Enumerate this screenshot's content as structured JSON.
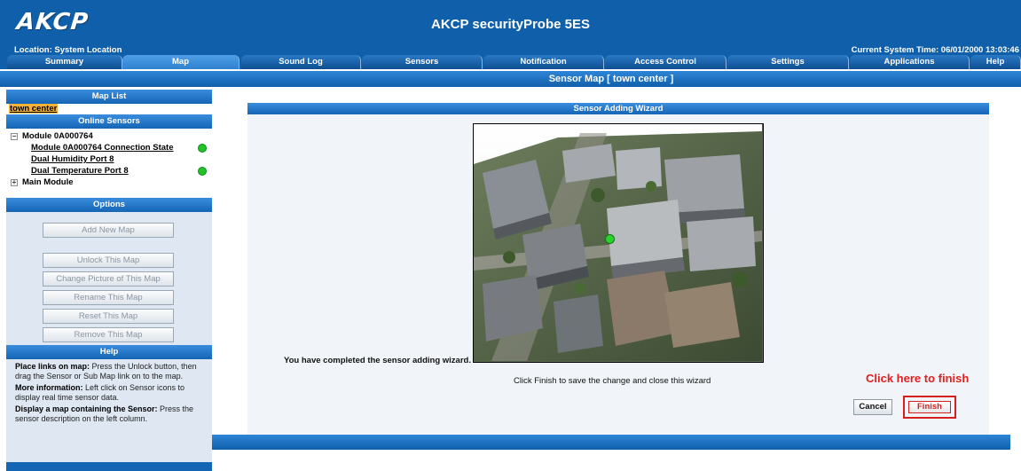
{
  "header": {
    "logo": "AKCP",
    "product_title": "AKCP securityProbe 5ES",
    "location": "Location: System Location",
    "system_time": "Current System Time: 06/01/2000 13:03:46"
  },
  "tabs": [
    {
      "label": "Summary",
      "active": false
    },
    {
      "label": "Map",
      "active": true
    },
    {
      "label": "Sound Log",
      "active": false
    },
    {
      "label": "Sensors",
      "active": false
    },
    {
      "label": "Notification",
      "active": false
    },
    {
      "label": "Access Control",
      "active": false
    },
    {
      "label": "Settings",
      "active": false
    },
    {
      "label": "Applications",
      "active": false
    },
    {
      "label": "Help",
      "active": false
    }
  ],
  "page_title": "Sensor Map [ town center ]",
  "sidebar": {
    "map_list_title": "Map List",
    "map_link": "town center",
    "online_sensors_title": "Online Sensors",
    "module_name": "Module 0A000764",
    "sensors": [
      {
        "label": "Module 0A000764 Connection State",
        "status": "online"
      },
      {
        "label": "Dual Humidity Port 8",
        "status": "none"
      },
      {
        "label": "Dual Temperature Port 8",
        "status": "online"
      }
    ],
    "main_module": "Main Module",
    "options_title": "Options",
    "options": [
      "Add New Map",
      "Unlock This Map",
      "Change Picture of This Map",
      "Rename This Map",
      "Reset This Map",
      "Remove This Map"
    ],
    "help_title": "Help",
    "help": {
      "p1_bold": "Place links on map:",
      "p1_text": " Press the Unlock button, then drag the Sensor or Sub Map link on to the map.",
      "p2_bold": "More information:",
      "p2_text": " Left click on Sensor icons to display real time sensor data.",
      "p3_bold": "Display a map containing the Sensor:",
      "p3_text": " Press the sensor description on the left column."
    }
  },
  "wizard": {
    "title": "Sensor Adding Wizard",
    "completed_message": "You have completed the sensor adding wizard.",
    "finish_instruction": "Click Finish to save the change and close this wizard",
    "callout": "Click here to finish",
    "cancel_label": "Cancel",
    "finish_label": "Finish"
  },
  "colors": {
    "header_blue": "#0f5faa",
    "online_green": "#22c32a",
    "highlight_orange": "#f5b23a",
    "callout_red": "#e02020"
  }
}
